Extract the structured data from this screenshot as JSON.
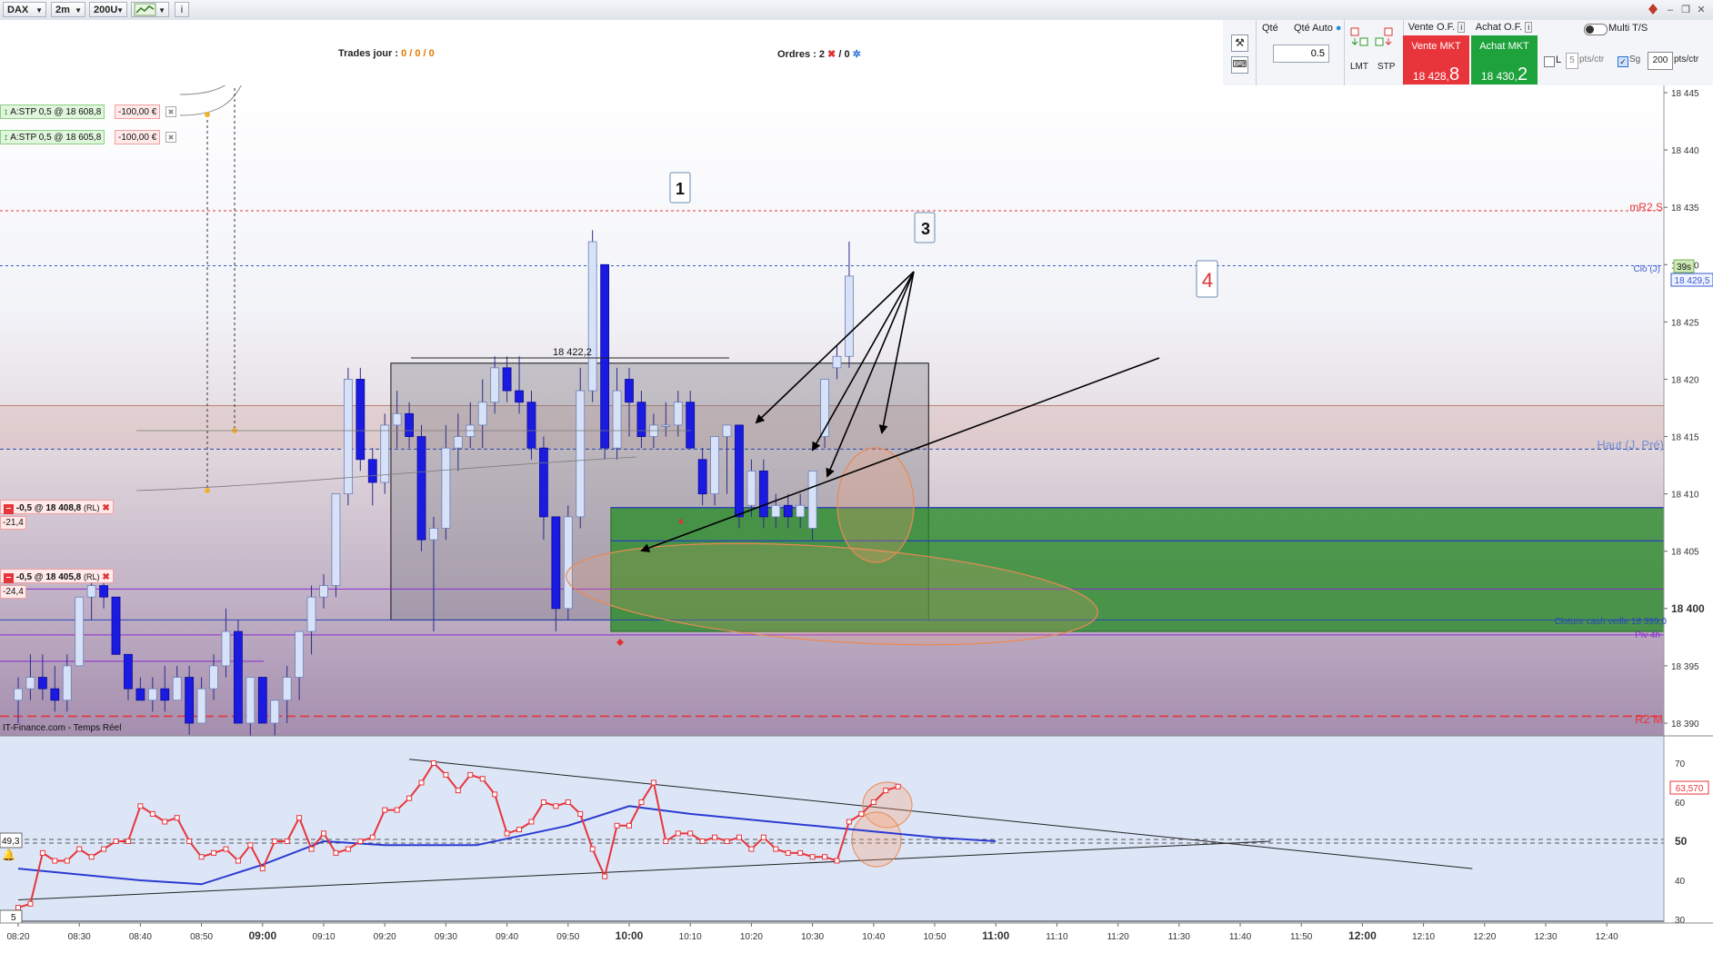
{
  "toolbar": {
    "instrument": "DAX",
    "timeframe": "2m",
    "units": "200U",
    "window_controls": [
      "minimize-icon",
      "restore-icon",
      "close-icon"
    ]
  },
  "header": {
    "trades_label": "Trades jour :",
    "trades_values": "0 / 0 / 0",
    "orders_label": "Ordres :",
    "orders_open": "2",
    "orders_sep": "/ 0"
  },
  "order_panel": {
    "qty_label": "Qté",
    "qty_auto_label": "Qté Auto",
    "qty_value": "0.5",
    "lmt_label": "LMT",
    "stp_label": "STP",
    "sell_of_label": "Vente O.F.",
    "buy_of_label": "Achat O.F.",
    "sell_mkt_label": "Vente MKT",
    "sell_price_prefix": "18 428,",
    "sell_price_big": "8",
    "buy_mkt_label": "Achat MKT",
    "buy_price_prefix": "18 430,",
    "buy_price_big": "2",
    "multi_label": "Multi T/S",
    "l_label": "L",
    "pts_value": "5",
    "pts_label": "pts/ctr",
    "sg_label": "Sg",
    "sg_value": "200",
    "sg_unit": "pts/ctr",
    "colors": {
      "sell": "#e8353b",
      "buy": "#1ea23b"
    }
  },
  "orders": [
    {
      "text": "A:STP  0,5  @  18 608,8",
      "amount": "-100,00 €"
    },
    {
      "text": "A:STP  0,5  @  18 605,8",
      "amount": "-100,00 €"
    }
  ],
  "positions": [
    {
      "text": "-0,5 @ 18 408,8",
      "tag": "(RL)",
      "pnl": "-21,4"
    },
    {
      "text": "-0,5 @ 18 405,8",
      "tag": "(RL)",
      "pnl": "-24,4"
    }
  ],
  "annotations": {
    "n1": "1",
    "n3": "3",
    "n4": "4",
    "range_high": "18 422,2"
  },
  "level_labels": {
    "mr2s": "mR2 S",
    "clo": "Clo (J)",
    "timer": "39s",
    "price_tag": "18 429,5",
    "haut": "Haut (J. Pré)",
    "cloture": "Cloture cash veille 18 399,0",
    "piv": "Piv 4h",
    "r2m": "R2 M",
    "source": "IT-Finance.com - Temps Réel"
  },
  "osc_labels": {
    "left_value": "49,3",
    "value_tag": "63,570",
    "bottom_left": "5"
  },
  "chart_data": {
    "type": "candlestick",
    "price_axis": {
      "min": 18390,
      "max": 18445,
      "ticks": [
        18445,
        18440,
        18435,
        18430,
        18425,
        18420,
        18415,
        18410,
        18405,
        18400,
        18395,
        18390
      ]
    },
    "time_labels": [
      {
        "t": "08:20",
        "bold": false
      },
      {
        "t": "08:30",
        "bold": false
      },
      {
        "t": "08:40",
        "bold": false
      },
      {
        "t": "08:50",
        "bold": false
      },
      {
        "t": "09:00",
        "bold": true
      },
      {
        "t": "09:10",
        "bold": false
      },
      {
        "t": "09:20",
        "bold": false
      },
      {
        "t": "09:30",
        "bold": false
      },
      {
        "t": "09:40",
        "bold": false
      },
      {
        "t": "09:50",
        "bold": false
      },
      {
        "t": "10:00",
        "bold": true
      },
      {
        "t": "10:10",
        "bold": false
      },
      {
        "t": "10:20",
        "bold": false
      },
      {
        "t": "10:30",
        "bold": false
      },
      {
        "t": "10:40",
        "bold": false
      },
      {
        "t": "10:50",
        "bold": false
      },
      {
        "t": "11:00",
        "bold": true
      },
      {
        "t": "11:10",
        "bold": false
      },
      {
        "t": "11:20",
        "bold": false
      },
      {
        "t": "11:30",
        "bold": false
      },
      {
        "t": "11:40",
        "bold": false
      },
      {
        "t": "11:50",
        "bold": false
      },
      {
        "t": "12:00",
        "bold": true
      },
      {
        "t": "12:10",
        "bold": false
      },
      {
        "t": "12:20",
        "bold": false
      },
      {
        "t": "12:30",
        "bold": false
      },
      {
        "t": "12:40",
        "bold": false
      }
    ],
    "levels": [
      {
        "name": "mR2 S",
        "price": 18434.7,
        "color": "#e8353b",
        "style": "dotted"
      },
      {
        "name": "Clo (J)",
        "price": 18429.9,
        "color": "#3a5bd1",
        "style": "dotted"
      },
      {
        "name": "Haut (J. Pré)",
        "price": 18413.9,
        "color": "#2847b8",
        "style": "dashed"
      },
      {
        "name": "Cloture cash veille",
        "price": 18399.0,
        "color": "#2847b8",
        "style": "solid"
      },
      {
        "name": "Piv 4h",
        "price": 18397.7,
        "color": "#8a2bd1",
        "style": "solid"
      },
      {
        "name": "R2 M",
        "price": 18390.6,
        "color": "#e8353b",
        "style": "dashed"
      }
    ],
    "candles": [
      {
        "o": 18392,
        "h": 18394,
        "l": 18390,
        "c": 18393
      },
      {
        "o": 18393,
        "h": 18396,
        "l": 18392,
        "c": 18394
      },
      {
        "o": 18394,
        "h": 18396,
        "l": 18392,
        "c": 18393
      },
      {
        "o": 18393,
        "h": 18395,
        "l": 18391,
        "c": 18392
      },
      {
        "o": 18392,
        "h": 18396,
        "l": 18391,
        "c": 18395
      },
      {
        "o": 18395,
        "h": 18401,
        "l": 18395,
        "c": 18401
      },
      {
        "o": 18401,
        "h": 18403,
        "l": 18399,
        "c": 18402
      },
      {
        "o": 18402,
        "h": 18403,
        "l": 18400,
        "c": 18401
      },
      {
        "o": 18401,
        "h": 18401,
        "l": 18397,
        "c": 18396
      },
      {
        "o": 18396,
        "h": 18396,
        "l": 18392,
        "c": 18393
      },
      {
        "o": 18393,
        "h": 18394,
        "l": 18392,
        "c": 18392
      },
      {
        "o": 18392,
        "h": 18394,
        "l": 18391,
        "c": 18393
      },
      {
        "o": 18393,
        "h": 18395,
        "l": 18391,
        "c": 18392
      },
      {
        "o": 18392,
        "h": 18395,
        "l": 18392,
        "c": 18394
      },
      {
        "o": 18394,
        "h": 18395,
        "l": 18389,
        "c": 18390
      },
      {
        "o": 18390,
        "h": 18394,
        "l": 18390,
        "c": 18393
      },
      {
        "o": 18393,
        "h": 18396,
        "l": 18392,
        "c": 18395
      },
      {
        "o": 18395,
        "h": 18400,
        "l": 18394,
        "c": 18398
      },
      {
        "o": 18398,
        "h": 18399,
        "l": 18390,
        "c": 18390
      },
      {
        "o": 18390,
        "h": 18394,
        "l": 18388,
        "c": 18394
      },
      {
        "o": 18394,
        "h": 18394,
        "l": 18390,
        "c": 18390
      },
      {
        "o": 18390,
        "h": 18392,
        "l": 18388,
        "c": 18392
      },
      {
        "o": 18392,
        "h": 18395,
        "l": 18390,
        "c": 18394
      },
      {
        "o": 18394,
        "h": 18398,
        "l": 18392,
        "c": 18398
      },
      {
        "o": 18398,
        "h": 18402,
        "l": 18396,
        "c": 18401
      },
      {
        "o": 18401,
        "h": 18403,
        "l": 18400,
        "c": 18402
      },
      {
        "o": 18402,
        "h": 18410,
        "l": 18401,
        "c": 18410
      },
      {
        "o": 18410,
        "h": 18421,
        "l": 18409,
        "c": 18420
      },
      {
        "o": 18420,
        "h": 18421,
        "l": 18412,
        "c": 18413
      },
      {
        "o": 18413,
        "h": 18414,
        "l": 18409,
        "c": 18411
      },
      {
        "o": 18411,
        "h": 18417,
        "l": 18410,
        "c": 18416
      },
      {
        "o": 18416,
        "h": 18419,
        "l": 18414,
        "c": 18417
      },
      {
        "o": 18417,
        "h": 18418,
        "l": 18414,
        "c": 18415
      },
      {
        "o": 18415,
        "h": 18416,
        "l": 18405,
        "c": 18406
      },
      {
        "o": 18406,
        "h": 18408,
        "l": 18398,
        "c": 18407
      },
      {
        "o": 18407,
        "h": 18416,
        "l": 18406,
        "c": 18414
      },
      {
        "o": 18414,
        "h": 18417,
        "l": 18412,
        "c": 18415
      },
      {
        "o": 18415,
        "h": 18418,
        "l": 18414,
        "c": 18416
      },
      {
        "o": 18416,
        "h": 18420,
        "l": 18414,
        "c": 18418
      },
      {
        "o": 18418,
        "h": 18422,
        "l": 18417,
        "c": 18421
      },
      {
        "o": 18421,
        "h": 18422,
        "l": 18418,
        "c": 18419
      },
      {
        "o": 18419,
        "h": 18422,
        "l": 18417,
        "c": 18418
      },
      {
        "o": 18418,
        "h": 18419,
        "l": 18413,
        "c": 18414
      },
      {
        "o": 18414,
        "h": 18415,
        "l": 18406,
        "c": 18408
      },
      {
        "o": 18408,
        "h": 18408,
        "l": 18398,
        "c": 18400
      },
      {
        "o": 18400,
        "h": 18409,
        "l": 18399,
        "c": 18408
      },
      {
        "o": 18408,
        "h": 18421,
        "l": 18407,
        "c": 18419
      },
      {
        "o": 18419,
        "h": 18433,
        "l": 18418,
        "c": 18432
      },
      {
        "o": 18430,
        "h": 18430,
        "l": 18413,
        "c": 18414
      },
      {
        "o": 18414,
        "h": 18421,
        "l": 18413,
        "c": 18419
      },
      {
        "o": 18420,
        "h": 18421,
        "l": 18415,
        "c": 18418
      },
      {
        "o": 18418,
        "h": 18419,
        "l": 18414,
        "c": 18415
      },
      {
        "o": 18415,
        "h": 18417,
        "l": 18414,
        "c": 18416
      },
      {
        "o": 18416,
        "h": 18418,
        "l": 18415,
        "c": 18416
      },
      {
        "o": 18416,
        "h": 18419,
        "l": 18415,
        "c": 18418
      },
      {
        "o": 18418,
        "h": 18419,
        "l": 18414,
        "c": 18414
      },
      {
        "o": 18413,
        "h": 18414,
        "l": 18409,
        "c": 18410
      },
      {
        "o": 18410,
        "h": 18415,
        "l": 18409,
        "c": 18415
      },
      {
        "o": 18415,
        "h": 18416,
        "l": 18410,
        "c": 18416
      },
      {
        "o": 18416,
        "h": 18416,
        "l": 18407,
        "c": 18408
      },
      {
        "o": 18409,
        "h": 18413,
        "l": 18408,
        "c": 18412
      },
      {
        "o": 18412,
        "h": 18413,
        "l": 18407,
        "c": 18408
      },
      {
        "o": 18408,
        "h": 18410,
        "l": 18407,
        "c": 18409
      },
      {
        "o": 18409,
        "h": 18410,
        "l": 18407,
        "c": 18408
      },
      {
        "o": 18408,
        "h": 18410,
        "l": 18407,
        "c": 18409
      },
      {
        "o": 18407,
        "h": 18412,
        "l": 18406,
        "c": 18412
      },
      {
        "o": 18415,
        "h": 18420,
        "l": 18414,
        "c": 18420
      },
      {
        "o": 18421,
        "h": 18423,
        "l": 18420,
        "c": 18422
      },
      {
        "o": 18422,
        "h": 18432,
        "l": 18421,
        "c": 18429
      }
    ],
    "candle_start_time": "08:20",
    "candle_minutes": 2,
    "zones": [
      {
        "name": "range-box",
        "t0": "09:21",
        "t1": "10:49",
        "low": 18399.0,
        "high": 18421.4,
        "color": "#8e8e9a"
      },
      {
        "name": "green-zone",
        "t0": "09:57",
        "t1": "12:50",
        "low": 18398.0,
        "high": 18408.8,
        "color": "#2e8b2e"
      }
    ],
    "oscillator": {
      "axis": {
        "min": 30,
        "max": 75,
        "ticks": [
          70,
          60,
          50,
          40,
          30
        ]
      },
      "rsi": [
        33,
        34,
        47,
        45,
        45,
        48,
        46,
        48,
        50,
        50,
        59,
        57,
        55,
        56,
        50,
        46,
        47,
        48,
        45,
        49,
        43,
        50,
        50,
        56,
        48,
        52,
        47,
        48,
        50,
        51,
        58,
        58,
        61,
        65,
        70,
        67,
        63,
        67,
        66,
        62,
        52,
        53,
        55,
        60,
        59,
        60,
        57,
        48,
        41,
        54,
        54,
        60,
        65,
        50,
        52,
        52,
        50,
        51,
        50,
        51,
        48,
        51,
        48,
        47,
        47,
        46,
        46,
        45,
        55,
        57,
        60,
        63,
        64
      ],
      "rsi_start_time": "08:20",
      "ma": [
        [
          "08:20",
          43
        ],
        [
          "08:40",
          40
        ],
        [
          "08:50",
          39
        ],
        [
          "09:00",
          44
        ],
        [
          "09:10",
          50
        ],
        [
          "09:20",
          49
        ],
        [
          "09:35",
          49
        ],
        [
          "09:50",
          54
        ],
        [
          "10:00",
          59
        ],
        [
          "10:10",
          57
        ],
        [
          "10:30",
          54
        ],
        [
          "10:50",
          51
        ],
        [
          "11:00",
          50
        ]
      ],
      "trend_upper": [
        [
          "09:24",
          71
        ],
        [
          "12:18",
          43
        ]
      ],
      "trend_lower": [
        [
          "08:20",
          35
        ],
        [
          "11:45",
          50
        ]
      ],
      "value": 63.57
    }
  }
}
